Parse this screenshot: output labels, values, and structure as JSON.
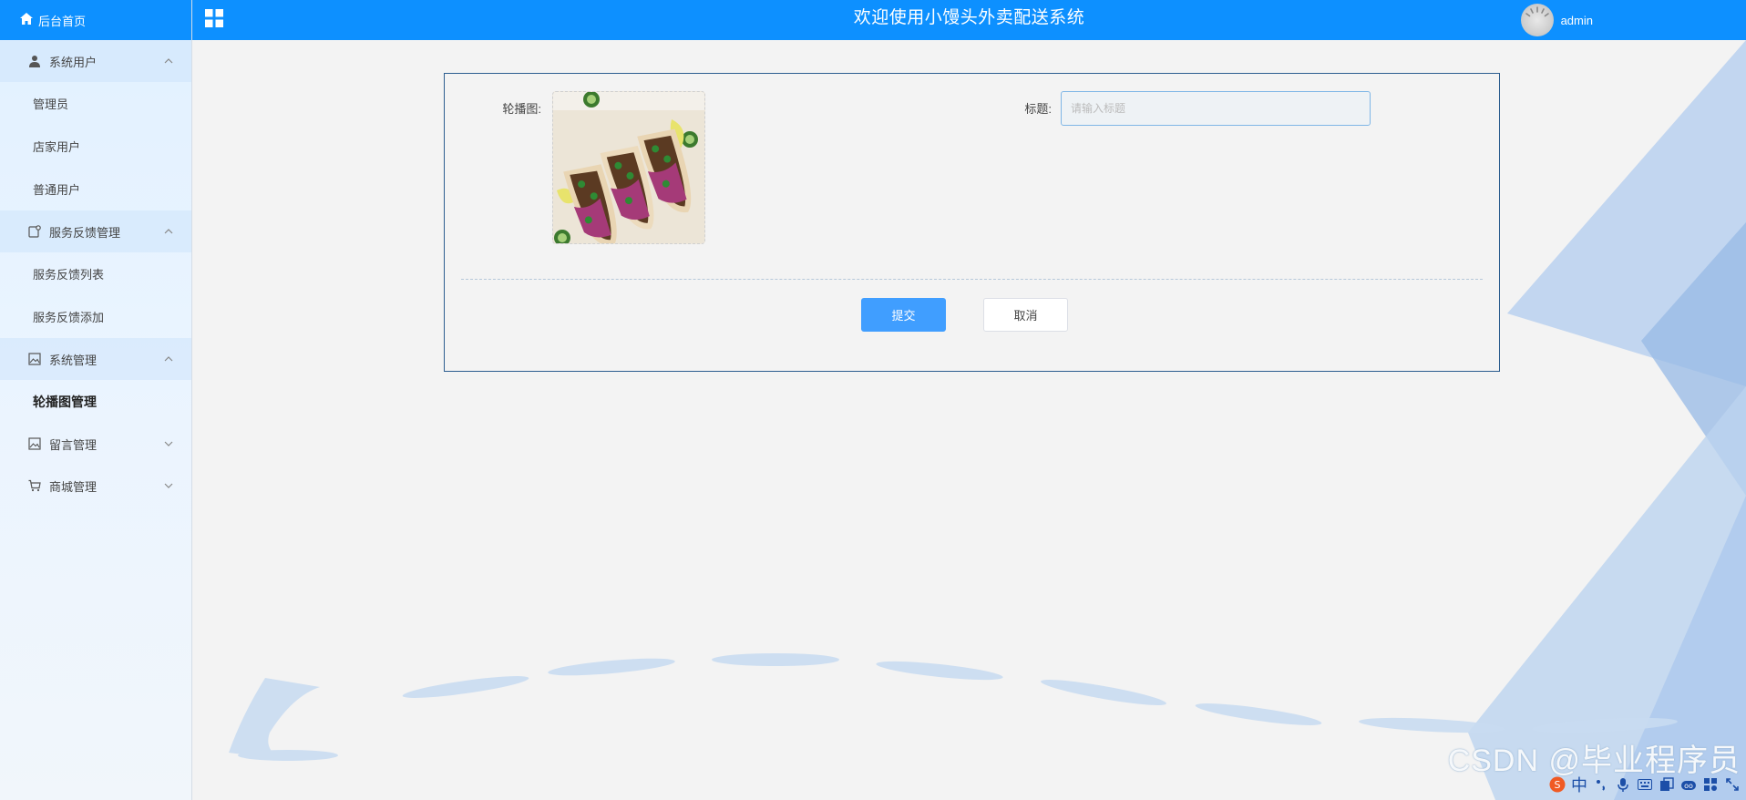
{
  "app": {
    "header_title": "欢迎使用小馒头外卖配送系统",
    "username": "admin"
  },
  "sidebar": {
    "home": "后台首页",
    "groups": [
      {
        "label": "系统用户",
        "icon": "user-icon",
        "expanded": true,
        "items": [
          "管理员",
          "店家用户",
          "普通用户"
        ]
      },
      {
        "label": "服务反馈管理",
        "icon": "feedback-icon",
        "expanded": true,
        "items": [
          "服务反馈列表",
          "服务反馈添加"
        ]
      },
      {
        "label": "系统管理",
        "icon": "image-icon",
        "expanded": true,
        "items": [
          "轮播图管理"
        ],
        "active_item": "轮播图管理"
      },
      {
        "label": "留言管理",
        "icon": "image-icon",
        "expanded": false,
        "items": []
      },
      {
        "label": "商城管理",
        "icon": "cart-icon",
        "expanded": false,
        "items": []
      }
    ]
  },
  "form": {
    "carousel_label": "轮播图:",
    "title_label": "标题:",
    "title_placeholder": "请输入标题",
    "title_value": "",
    "submit_label": "提交",
    "cancel_label": "取消"
  },
  "overlay": {
    "watermark": "CSDN @毕业程序员",
    "ime_char": "中"
  },
  "colors": {
    "primary": "#0d90ff",
    "button_primary": "#409eff",
    "panel_border": "#2c5d8f"
  }
}
